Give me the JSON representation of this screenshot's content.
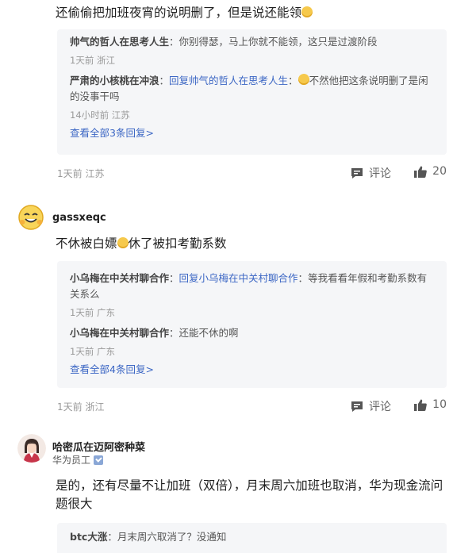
{
  "comments": [
    {
      "text": "还偷偷把加班夜宵的说明删了，但是说还能领",
      "emoji": "😆",
      "replies": [
        {
          "author": "帅气的哲人在思考人生",
          "reply_to": "",
          "text": "你别得瑟，马上你就不能领，这只是过渡阶段",
          "meta": "1天前 浙江"
        },
        {
          "author": "严肃的小核桃在冲浪",
          "reply_to": "回复帅气的哲人在思考人生",
          "emoji": "😆",
          "text": "不然他把这条说明删了是闲的没事干吗",
          "meta": "14小时前 江苏"
        }
      ],
      "more_replies": "查看全部3条回复>",
      "meta": "1天前 江苏",
      "comment_label": "评论",
      "likes": "20"
    },
    {
      "author": "gassxeqc",
      "text_before": "不休被白嫖",
      "text_after": "休了被扣考勤系数",
      "emoji": "😆",
      "replies": [
        {
          "author": "小乌梅在中关村聊合作",
          "reply_to": "回复小乌梅在中关村聊合作",
          "text": "等我看看年假和考勤系数有关系么",
          "meta": "1天前 广东"
        },
        {
          "author": "小乌梅在中关村聊合作",
          "reply_to": "",
          "text": "还能不休的啊",
          "meta": "1天前 广东"
        }
      ],
      "more_replies": "查看全部4条回复>",
      "meta": "1天前 浙江",
      "comment_label": "评论",
      "likes": "10"
    },
    {
      "author": "哈密瓜在迈阿密种菜",
      "author_title": "华为员工",
      "text": "是的，还有尽量不让加班（双倍），月末周六加班也取消，华为现金流问题很大",
      "replies": [
        {
          "author": "btc大涨",
          "text": "月末周六取消了？没通知"
        }
      ]
    }
  ],
  "colors": {
    "link": "#3b66c4",
    "reply_bg": "#f5f6f8",
    "meta": "#999999"
  },
  "icons": {
    "comment": "comment-icon",
    "like": "thumbs-up-icon",
    "verify": "verified-badge-icon"
  }
}
